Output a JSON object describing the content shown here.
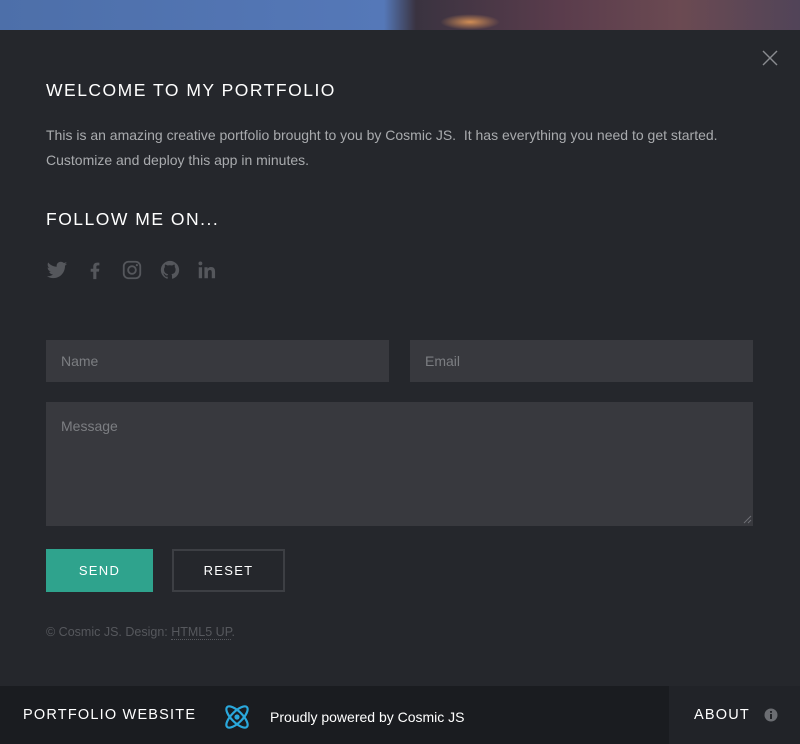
{
  "background": {
    "accent_blue": "#5578b8",
    "accent_warm": "#6b4a52"
  },
  "modal": {
    "close_icon": "close-icon",
    "welcome_heading": "WELCOME TO MY PORTFOLIO",
    "intro_text": "This is an amazing creative portfolio brought to you by Cosmic JS.  It has everything you need to get started.  Customize and deploy this app in minutes.",
    "follow_heading": "FOLLOW ME ON...",
    "social_icons": [
      "twitter-icon",
      "facebook-icon",
      "instagram-icon",
      "github-icon",
      "linkedin-icon"
    ]
  },
  "form": {
    "name_placeholder": "Name",
    "email_placeholder": "Email",
    "message_placeholder": "Message",
    "send_label": "SEND",
    "reset_label": "RESET",
    "send_color": "#2fa38d"
  },
  "copyright": {
    "prefix": "© Cosmic JS. Design: ",
    "link_text": "HTML5 UP",
    "suffix": "."
  },
  "footer": {
    "brand": "PORTFOLIO WEBSITE",
    "powered_icon": "cosmic-js-logo-icon",
    "powered_text": "Proudly powered by Cosmic JS",
    "about_label": "ABOUT",
    "about_icon": "info-icon"
  }
}
